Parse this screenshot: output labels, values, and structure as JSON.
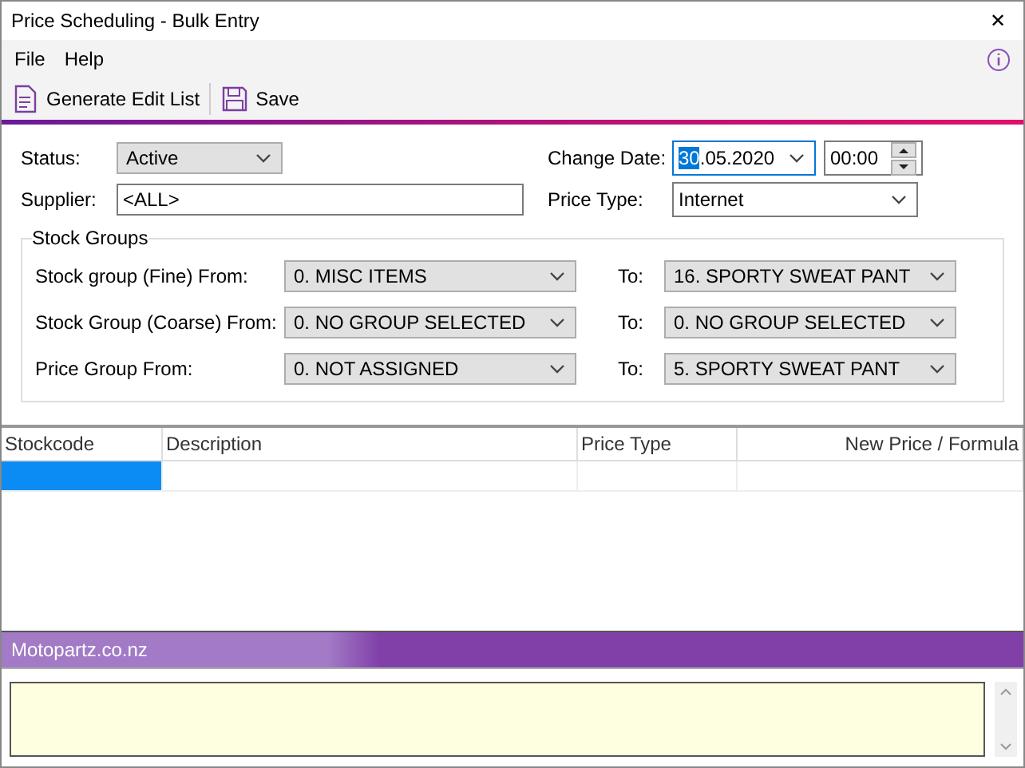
{
  "window": {
    "title": "Price Scheduling - Bulk Entry",
    "close": "✕"
  },
  "menu": [
    "File",
    "Help"
  ],
  "toolbar": [
    {
      "label": "Generate Edit List",
      "kind": "list"
    },
    {
      "label": "Save",
      "kind": "save"
    }
  ],
  "form": {
    "status": {
      "label": "Status:",
      "value": "Active"
    },
    "supplier": {
      "label": "Supplier:",
      "value": "<ALL>"
    },
    "change_date": {
      "label": "Change Date:",
      "selected_part": "30",
      "rest": ".05.2020",
      "time": "00:00"
    },
    "price_type": {
      "label": "Price Type:",
      "value": "Internet"
    }
  },
  "stock_groups": {
    "title": "Stock Groups",
    "rows": [
      {
        "label": "Stock group (Fine) From:",
        "from": "0. MISC ITEMS",
        "to_label": "To:",
        "to": "16. SPORTY SWEAT PANT"
      },
      {
        "label": "Stock Group (Coarse) From:",
        "from": "0. NO GROUP SELECTED",
        "to_label": "To:",
        "to": "0. NO GROUP SELECTED"
      },
      {
        "label": "Price Group From:",
        "from": "0. NOT ASSIGNED",
        "to_label": "To:",
        "to": "5. SPORTY SWEAT PANT"
      }
    ]
  },
  "table": {
    "columns": [
      "Stockcode",
      "Description",
      "Price Type",
      "New Price / Formula"
    ],
    "rows": [
      {
        "cells": [
          {
            "selected": true
          },
          {
            "selected": false
          },
          {
            "selected": false
          },
          {
            "selected": false
          }
        ]
      }
    ]
  },
  "status_bar": {
    "text": "Motopartz.co.nz"
  }
}
